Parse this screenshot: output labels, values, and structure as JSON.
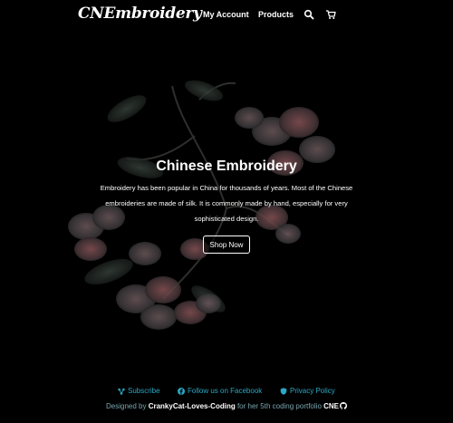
{
  "nav": {
    "brand": "CNEmbroidery",
    "links": [
      {
        "label": "My Account"
      },
      {
        "label": "Products"
      }
    ],
    "icons": [
      "search-icon",
      "cart-icon"
    ]
  },
  "hero": {
    "title": "Chinese Embroidery",
    "description": "Embroidery has been popular in China for thousands of years. Most of the Chinese embroideries are made of silk. It is commonly made by hand, especially for very sophisticated design.",
    "button_label": "Shop Now"
  },
  "footer": {
    "links": [
      {
        "label": "Subscribe",
        "icon": "share-icon"
      },
      {
        "label": "Follow us on Facebook",
        "icon": "facebook-icon"
      },
      {
        "label": "Privacy Policy",
        "icon": "shield-icon"
      }
    ],
    "credit": {
      "prefix": "Designed by ",
      "author": "CrankyCat-Loves-Coding",
      "middle": " for her 5th coding portfolio ",
      "project": "CNE",
      "icon": "github-icon"
    }
  },
  "colors": {
    "background": "#000000",
    "accent": "#2aa8c4",
    "text": "#ffffff"
  }
}
